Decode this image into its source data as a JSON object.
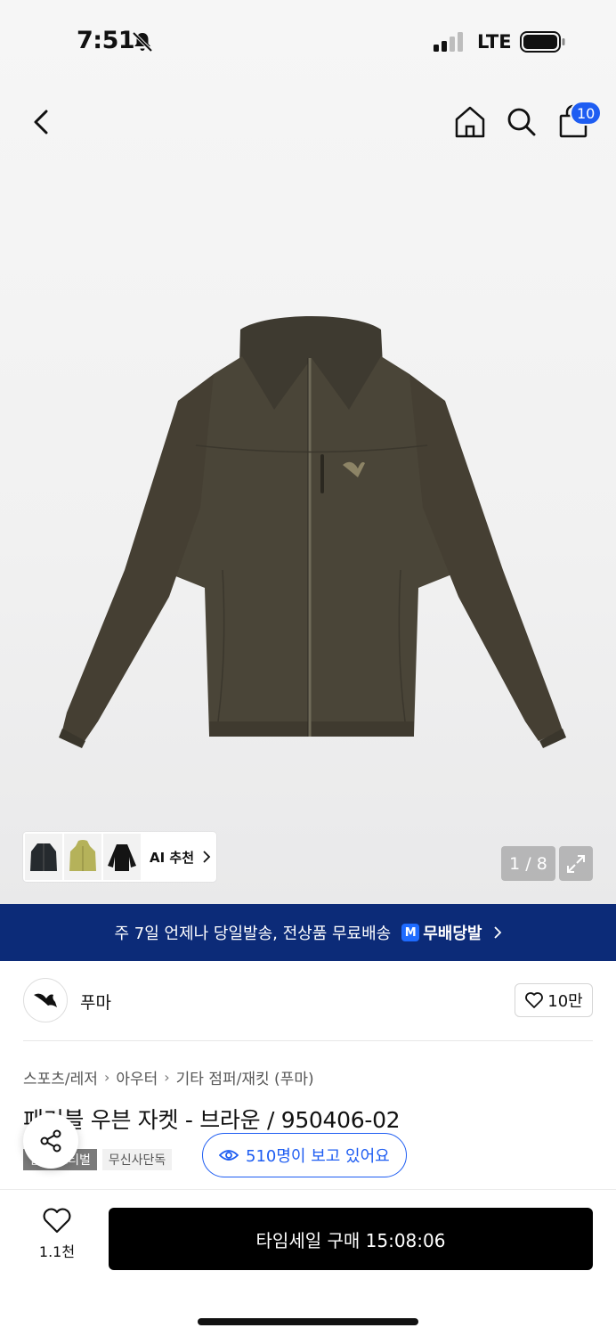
{
  "status_bar": {
    "time": "7:51",
    "network": "LTE"
  },
  "nav": {
    "cart_count": "10"
  },
  "gallery": {
    "counter": "1 / 8",
    "ai_recommend_label": "AI 추천"
  },
  "shipping": {
    "text": "주 7일 언제나 당일발송, 전상품 무료배송",
    "logo_letter": "M",
    "brand": "무배당발"
  },
  "brand": {
    "name": "푸마",
    "likes": "10만"
  },
  "breadcrumb": [
    "스포츠/레저",
    "아우터",
    "기타 점퍼/재킷 (푸마)"
  ],
  "product": {
    "title": "패커블 우븐 자켓 - 브라운 / 950406-02",
    "tags": [
      "웹 페스티벌",
      "무신사단독"
    ],
    "viewers": "510명이 보고 있어요"
  },
  "bottom": {
    "wish_count": "1.1천",
    "buy_label": "타임세일 구매 15:08:06"
  },
  "colors": {
    "accent_blue": "#1e5df2",
    "banner_navy": "#0c2b78",
    "jacket_brown": "#4a4538"
  },
  "icons": [
    "bell-slash-icon",
    "signal-icon",
    "battery-icon",
    "back-arrow-icon",
    "home-icon",
    "search-icon",
    "shopping-bag-icon",
    "chevron-right-icon",
    "expand-icon",
    "heart-icon",
    "eye-icon",
    "share-icon"
  ]
}
